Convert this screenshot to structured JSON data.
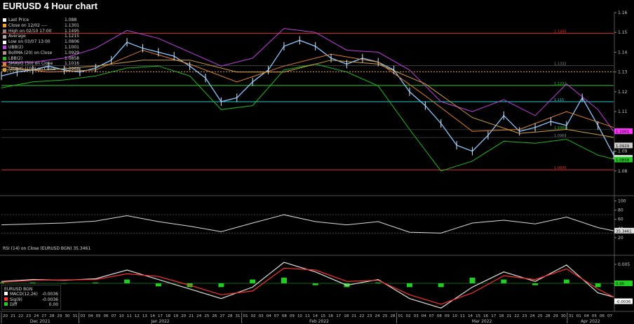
{
  "title": "EURUSD 4 Hour chart",
  "legend": [
    {
      "label": "Last Price",
      "value": "1.088",
      "color": "#ffffff"
    },
    {
      "label": "Close on 12/02 ----",
      "value": "1.1301",
      "color": "#f0a030"
    },
    {
      "label": "High on 02/10 17:00",
      "value": "1.1495",
      "color": "#888888"
    },
    {
      "label": "Average",
      "value": "1.1215",
      "color": "#aaaaaa"
    },
    {
      "label": "Low on 03/07 13:00",
      "value": "1.0806",
      "color": "#ffffff"
    },
    {
      "label": "UBB(2)",
      "value": "1.1001",
      "color": "#c040e0"
    },
    {
      "label": "BollMA (20)  on Close",
      "value": "1.0929",
      "color": "#b09090"
    },
    {
      "label": "LBB(2)",
      "value": "1.0858",
      "color": "#22bb22"
    },
    {
      "label": "SMAVG (50)  on Close",
      "value": "1.1016",
      "color": "#e08030"
    },
    {
      "label": "SMAVG (100)  on Close",
      "value": "1.0968",
      "color": "#d0a040"
    }
  ],
  "rsi_legend": "RSI (14)  on Close (EURUSD BGN) 35.3461",
  "macd_legend": {
    "title": "EURUSD BGN",
    "rows": [
      {
        "label": "MACD(12,26)",
        "value": "-0.0036",
        "color": "#ffffff"
      },
      {
        "label": "Sig(9)",
        "value": "-0.0036",
        "color": "#ff3030"
      },
      {
        "label": "Diff",
        "value": "0.00",
        "color": "#22cc22"
      }
    ]
  },
  "level_labels": [
    {
      "text": "1.1495",
      "color": "#e03030"
    },
    {
      "text": "1.1332",
      "color": "#888888"
    },
    {
      "text": "1.1232",
      "color": "#22cc22"
    },
    {
      "text": "1.115",
      "color": "#22cccc"
    },
    {
      "text": "1.1009",
      "color": "#22cc22"
    },
    {
      "text": "1.0969",
      "color": "#888888"
    },
    {
      "text": "1.0806",
      "color": "#e03030"
    }
  ],
  "price_badges": [
    {
      "text": "1.1001",
      "color": "#ff33ff"
    },
    {
      "text": "1.0929",
      "color": "#cccccc"
    },
    {
      "text": "1.088",
      "color": "#ffffff"
    },
    {
      "text": "1.0858",
      "color": "#22cc22"
    }
  ],
  "rsi_badge": "35.3461",
  "macd_badges": [
    {
      "text": "0.00",
      "color": "#22cc22"
    },
    {
      "text": "-0.0036",
      "color": "#ffffff"
    }
  ],
  "chart_data": [
    {
      "type": "line",
      "title": "EURUSD 4 Hour chart",
      "ylim": [
        1.07,
        1.16
      ],
      "yticks": [
        1.08,
        1.09,
        1.1,
        1.11,
        1.12,
        1.13,
        1.14,
        1.15,
        1.16
      ],
      "ytick_labels": [
        "1.08",
        "1.09",
        "1.10",
        "1.11",
        "1.12",
        "1.13",
        "1.14",
        "1.15",
        "1.16"
      ],
      "grid": false,
      "horizontal_levels": [
        1.1495,
        1.1332,
        1.1301,
        1.1232,
        1.115,
        1.1009,
        1.0969,
        1.0806
      ],
      "x_day_labels": [
        "20",
        "21",
        "22",
        "23",
        "24",
        "27",
        "28",
        "29",
        "30",
        "31",
        "03",
        "04",
        "05",
        "06",
        "07",
        "10",
        "11",
        "12",
        "13",
        "14",
        "17",
        "18",
        "19",
        "20",
        "21",
        "24",
        "25",
        "26",
        "27",
        "28",
        "31",
        "01",
        "02",
        "03",
        "04",
        "07",
        "08",
        "09",
        "10",
        "11",
        "14",
        "15",
        "16",
        "17",
        "18",
        "21",
        "22",
        "23",
        "24",
        "25",
        "28",
        "01",
        "02",
        "03",
        "04",
        "07",
        "08",
        "09",
        "10",
        "11",
        "14",
        "15",
        "16",
        "17",
        "18",
        "21",
        "22",
        "23",
        "24",
        "25",
        "28",
        "29",
        "30",
        "31",
        "01",
        "04",
        "05",
        "06",
        "07"
      ],
      "x_month_labels": [
        "Dec 2021",
        "Jan 2022",
        "Feb 2022",
        "Mar 2022",
        "Apr 2022"
      ],
      "series": [
        {
          "name": "Last Price",
          "x": [
            0,
            2,
            4,
            6,
            8,
            10,
            12,
            14,
            16,
            18,
            20,
            22,
            24,
            26,
            28,
            30,
            32,
            34,
            36,
            38,
            40,
            42,
            44,
            46,
            48,
            50,
            52,
            54,
            56,
            58,
            60,
            62,
            64,
            66,
            68,
            70,
            72,
            74,
            76,
            78
          ],
          "values": [
            1.128,
            1.13,
            1.131,
            1.133,
            1.131,
            1.13,
            1.132,
            1.136,
            1.145,
            1.142,
            1.14,
            1.138,
            1.133,
            1.127,
            1.115,
            1.117,
            1.125,
            1.131,
            1.143,
            1.146,
            1.143,
            1.137,
            1.134,
            1.137,
            1.135,
            1.131,
            1.12,
            1.113,
            1.104,
            1.093,
            1.09,
            1.098,
            1.108,
            1.1,
            1.102,
            1.105,
            1.103,
            1.117,
            1.103,
            1.088
          ]
        },
        {
          "name": "UBB(2)",
          "x": [
            0,
            4,
            8,
            12,
            16,
            20,
            24,
            28,
            32,
            36,
            40,
            44,
            48,
            52,
            56,
            60,
            64,
            68,
            72,
            76,
            78
          ],
          "values": [
            1.135,
            1.135,
            1.137,
            1.142,
            1.151,
            1.147,
            1.14,
            1.133,
            1.137,
            1.152,
            1.15,
            1.141,
            1.14,
            1.131,
            1.115,
            1.11,
            1.116,
            1.108,
            1.124,
            1.111,
            1.1
          ]
        },
        {
          "name": "LBB(2)",
          "x": [
            0,
            4,
            8,
            12,
            16,
            20,
            24,
            28,
            32,
            36,
            40,
            44,
            48,
            52,
            56,
            60,
            64,
            68,
            72,
            76,
            78
          ],
          "values": [
            1.122,
            1.125,
            1.126,
            1.128,
            1.132,
            1.133,
            1.128,
            1.111,
            1.113,
            1.131,
            1.134,
            1.13,
            1.123,
            1.101,
            1.08,
            1.085,
            1.095,
            1.094,
            1.096,
            1.088,
            1.086
          ]
        },
        {
          "name": "SMAVG (50)  on Close",
          "x": [
            0,
            6,
            12,
            18,
            24,
            30,
            36,
            42,
            48,
            54,
            60,
            66,
            72,
            78
          ],
          "values": [
            1.133,
            1.13,
            1.131,
            1.141,
            1.134,
            1.125,
            1.133,
            1.139,
            1.135,
            1.118,
            1.1,
            1.101,
            1.11,
            1.102
          ]
        },
        {
          "name": "SMAVG (100)  on Close",
          "x": [
            0,
            6,
            12,
            18,
            24,
            30,
            36,
            42,
            48,
            54,
            60,
            66,
            72,
            78
          ],
          "values": [
            1.131,
            1.131,
            1.133,
            1.136,
            1.136,
            1.13,
            1.13,
            1.136,
            1.134,
            1.124,
            1.107,
            1.099,
            1.101,
            1.097
          ]
        }
      ]
    },
    {
      "type": "line",
      "title": "RSI (14)",
      "ylim": [
        0,
        110
      ],
      "yticks": [
        20,
        40,
        60,
        80,
        100
      ],
      "ytick_labels": [
        "20",
        "40",
        "60",
        "80",
        "100"
      ],
      "series": [
        {
          "name": "RSI (14)  on Close (EURUSD BGN)",
          "x": [
            0,
            4,
            8,
            12,
            16,
            20,
            24,
            28,
            32,
            36,
            40,
            44,
            48,
            52,
            56,
            60,
            64,
            68,
            72,
            76,
            78
          ],
          "values": [
            48,
            50,
            52,
            56,
            68,
            55,
            45,
            33,
            52,
            70,
            55,
            48,
            55,
            32,
            30,
            52,
            58,
            50,
            65,
            42,
            35
          ]
        }
      ]
    },
    {
      "type": "bar",
      "title": "MACD",
      "ylim": [
        -0.007,
        0.007
      ],
      "yticks": [
        -0.005,
        0.0,
        0.005
      ],
      "ytick_labels": [
        "-0.005",
        "0.00",
        "0.005"
      ],
      "series": [
        {
          "name": "MACD(12,26)",
          "x": [
            0,
            4,
            8,
            12,
            16,
            20,
            24,
            28,
            32,
            36,
            40,
            44,
            48,
            52,
            56,
            60,
            64,
            68,
            72,
            76,
            78
          ],
          "values": [
            0.0005,
            0.001,
            0.0008,
            0.0012,
            0.0035,
            0.001,
            -0.0015,
            -0.004,
            -0.001,
            0.0055,
            0.003,
            -0.0005,
            0.001,
            -0.004,
            -0.0065,
            -0.001,
            0.003,
            0.0005,
            0.0048,
            -0.0025,
            -0.0036
          ]
        },
        {
          "name": "Sig(9)",
          "x": [
            0,
            4,
            8,
            12,
            16,
            20,
            24,
            28,
            32,
            36,
            40,
            44,
            48,
            52,
            56,
            60,
            64,
            68,
            72,
            76,
            78
          ],
          "values": [
            0.0003,
            0.0008,
            0.0009,
            0.001,
            0.0025,
            0.0018,
            -0.0005,
            -0.003,
            -0.002,
            0.004,
            0.0035,
            0.0005,
            0.0008,
            -0.003,
            -0.0055,
            -0.0025,
            0.002,
            0.001,
            0.0038,
            -0.0015,
            -0.0036
          ]
        },
        {
          "name": "Diff",
          "x": [
            0,
            4,
            8,
            12,
            16,
            20,
            24,
            28,
            32,
            36,
            40,
            44,
            48,
            52,
            56,
            60,
            64,
            68,
            72,
            76,
            78
          ],
          "values": [
            0.0002,
            0.0002,
            -0.0001,
            0.0002,
            0.001,
            -0.0008,
            -0.001,
            -0.001,
            0.001,
            0.0015,
            -0.0005,
            -0.001,
            0.0002,
            -0.001,
            -0.001,
            0.0015,
            0.001,
            -0.0005,
            0.001,
            -0.001,
            0.0
          ]
        }
      ]
    }
  ]
}
